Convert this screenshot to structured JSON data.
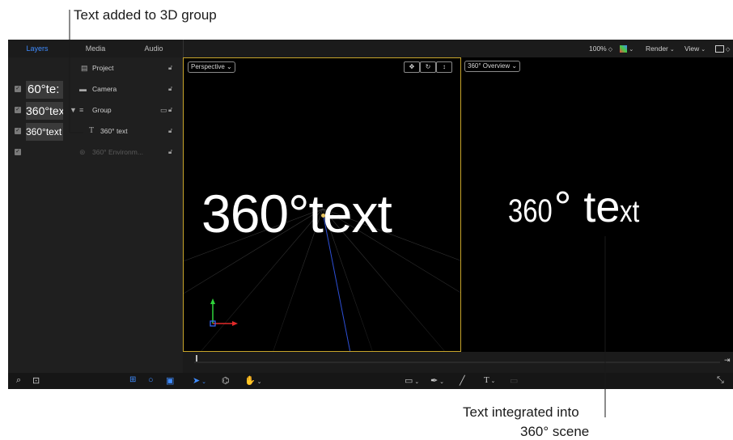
{
  "callouts": {
    "top": "Text added to 3D group",
    "bottom_line1": "Text integrated into",
    "bottom_line2": "360° scene"
  },
  "tabs": [
    {
      "label": "Layers",
      "active": true
    },
    {
      "label": "Media",
      "active": false
    },
    {
      "label": "Audio",
      "active": false
    }
  ],
  "toolbar": {
    "zoom": "100%",
    "render_label": "Render",
    "view_label": "View"
  },
  "layers": [
    {
      "thumb": "",
      "icon": "document-icon",
      "label": "Project"
    },
    {
      "thumb": "60°te:",
      "icon": "camera-icon",
      "label": "Camera"
    },
    {
      "thumb": "360°tex",
      "icon": "group-icon",
      "label": "Group"
    },
    {
      "thumb": "360°text",
      "icon": "text-icon",
      "label": "360° text"
    },
    {
      "thumb": "",
      "icon": "environment-icon",
      "label": "360° Environm..."
    }
  ],
  "viewer": {
    "mode": "Perspective",
    "text": "360°text"
  },
  "overview": {
    "mode": "360° Overview",
    "text_part1": "360",
    "text_part2": "° te",
    "text_part3": "xt"
  },
  "colors": {
    "accent": "#3f8cff",
    "viewer_border": "#c8a52a",
    "panel_bg": "#1f1f1f"
  }
}
